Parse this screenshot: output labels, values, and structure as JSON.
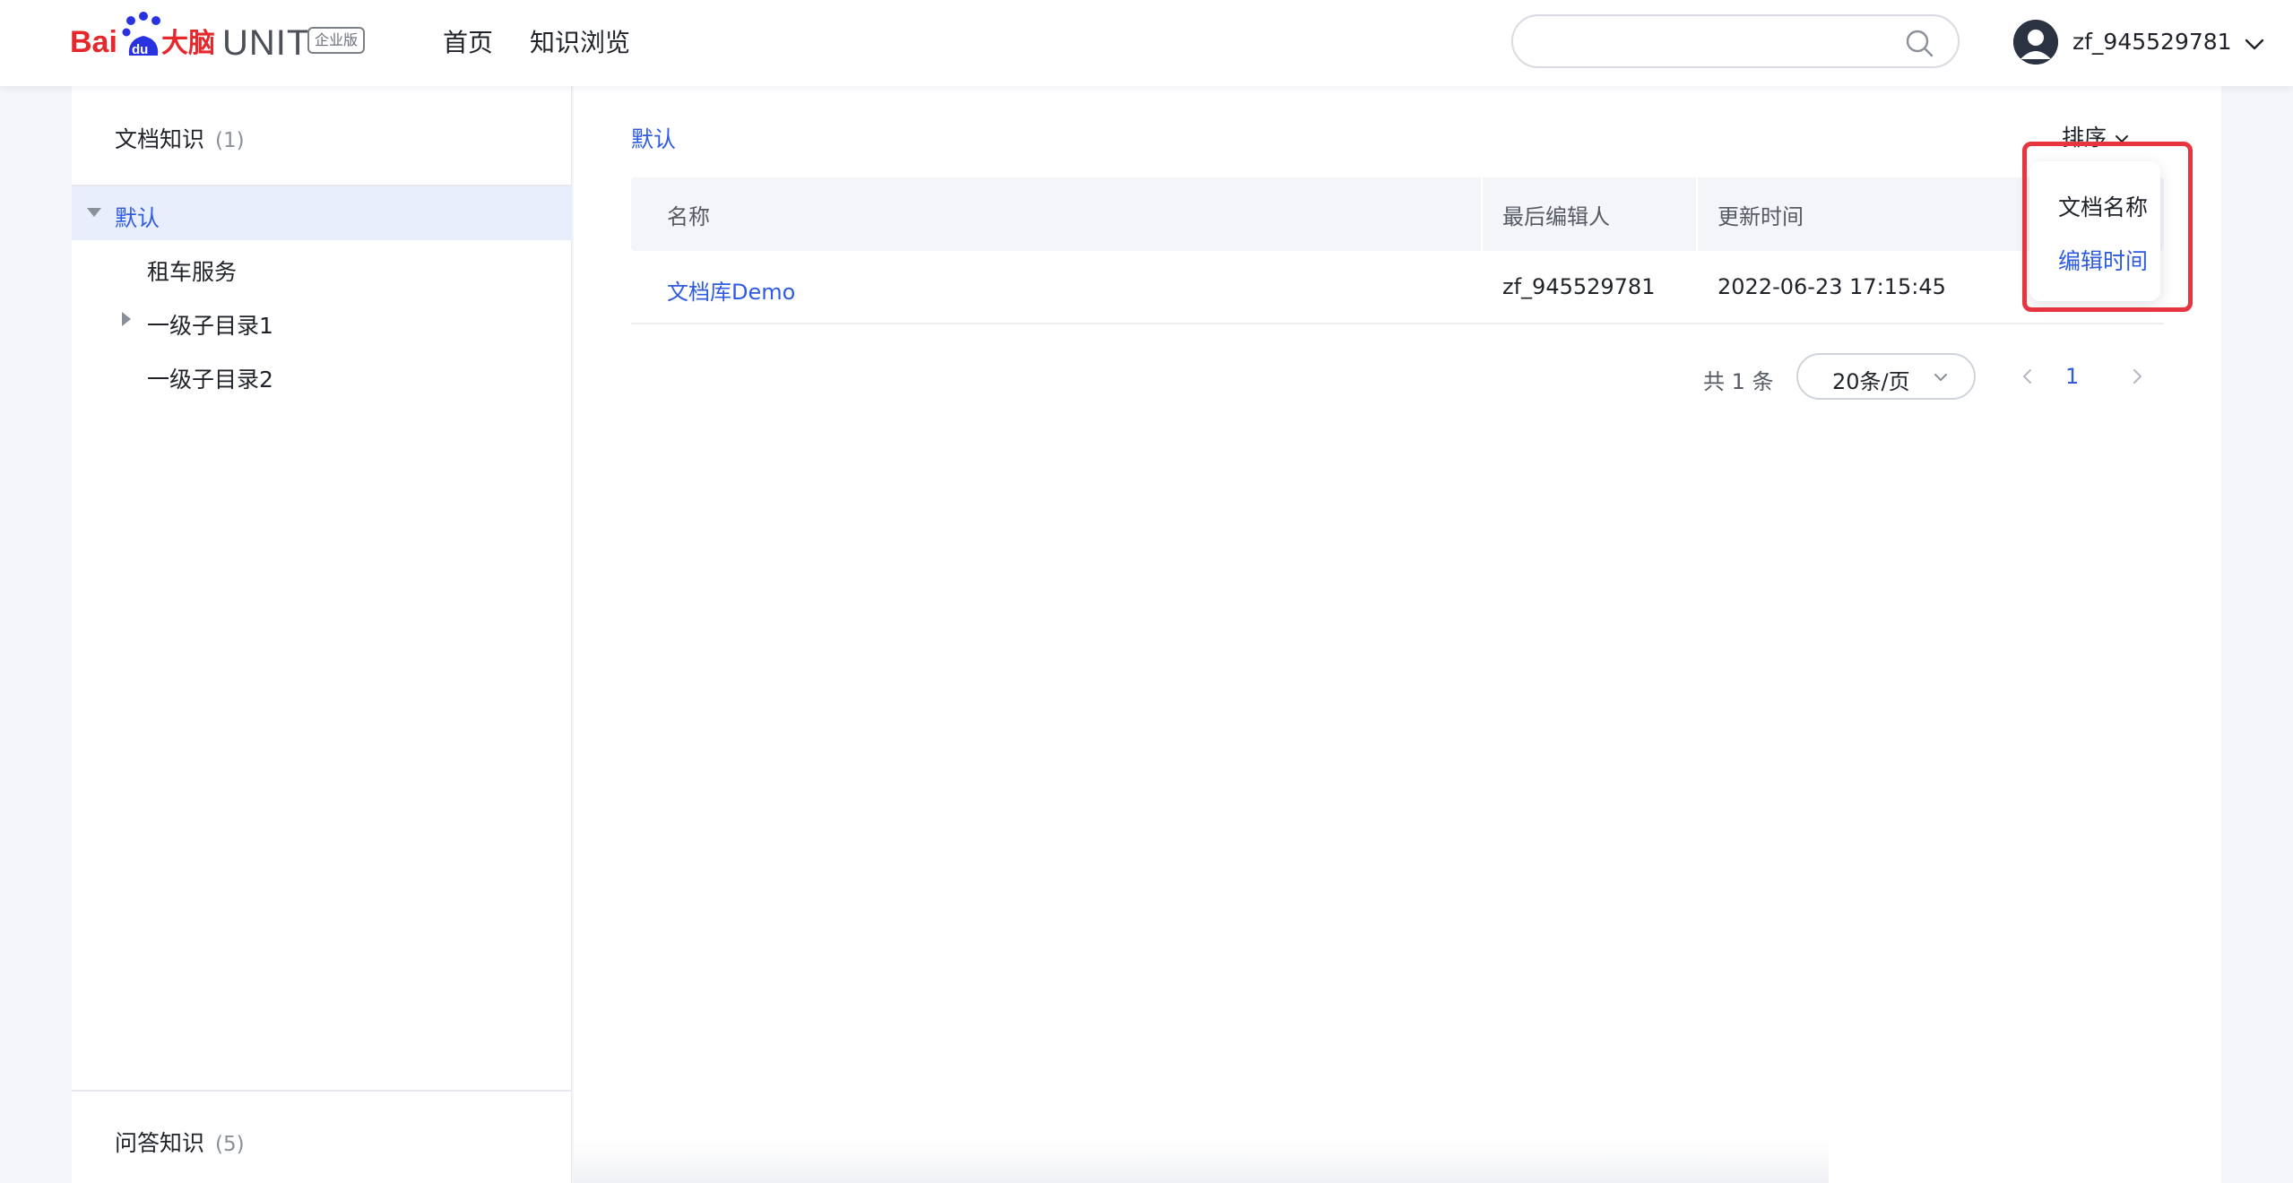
{
  "header": {
    "logo_text_bai": "Bai",
    "logo_text_du": "du",
    "logo_text_danao": "大脑",
    "logo_unit": "UNIT",
    "logo_badge": "企业版",
    "nav": [
      {
        "label": "首页"
      },
      {
        "label": "知识浏览"
      }
    ],
    "search": {
      "value": "",
      "placeholder": ""
    },
    "user": {
      "name": "zf_945529781"
    }
  },
  "sidebar": {
    "doc_section": {
      "label": "文档知识",
      "count": "(1)"
    },
    "tree": [
      {
        "label": "默认",
        "expanded": true,
        "selected": true
      },
      {
        "label": "租车服务"
      },
      {
        "label": "一级子目录1",
        "expandable": true
      },
      {
        "label": "一级子目录2"
      }
    ],
    "qa_section": {
      "label": "问答知识",
      "count": "(5)"
    }
  },
  "main": {
    "breadcrumb": "默认",
    "sort_label": "排序",
    "sort_menu": {
      "options": [
        {
          "label": "文档名称",
          "active": false
        },
        {
          "label": "编辑时间",
          "active": true
        }
      ]
    },
    "table": {
      "columns": [
        "名称",
        "最后编辑人",
        "更新时间"
      ],
      "rows": [
        {
          "name": "文档库Demo",
          "editor": "zf_945529781",
          "updated": "2022-06-23 17:15:45"
        }
      ]
    },
    "pagination": {
      "total": "共 1 条",
      "page_size": "20条/页",
      "current_page": "1"
    }
  },
  "colors": {
    "accent": "#2e5be0",
    "highlight": "#e8343e",
    "selected_bg": "#e9eefc"
  }
}
